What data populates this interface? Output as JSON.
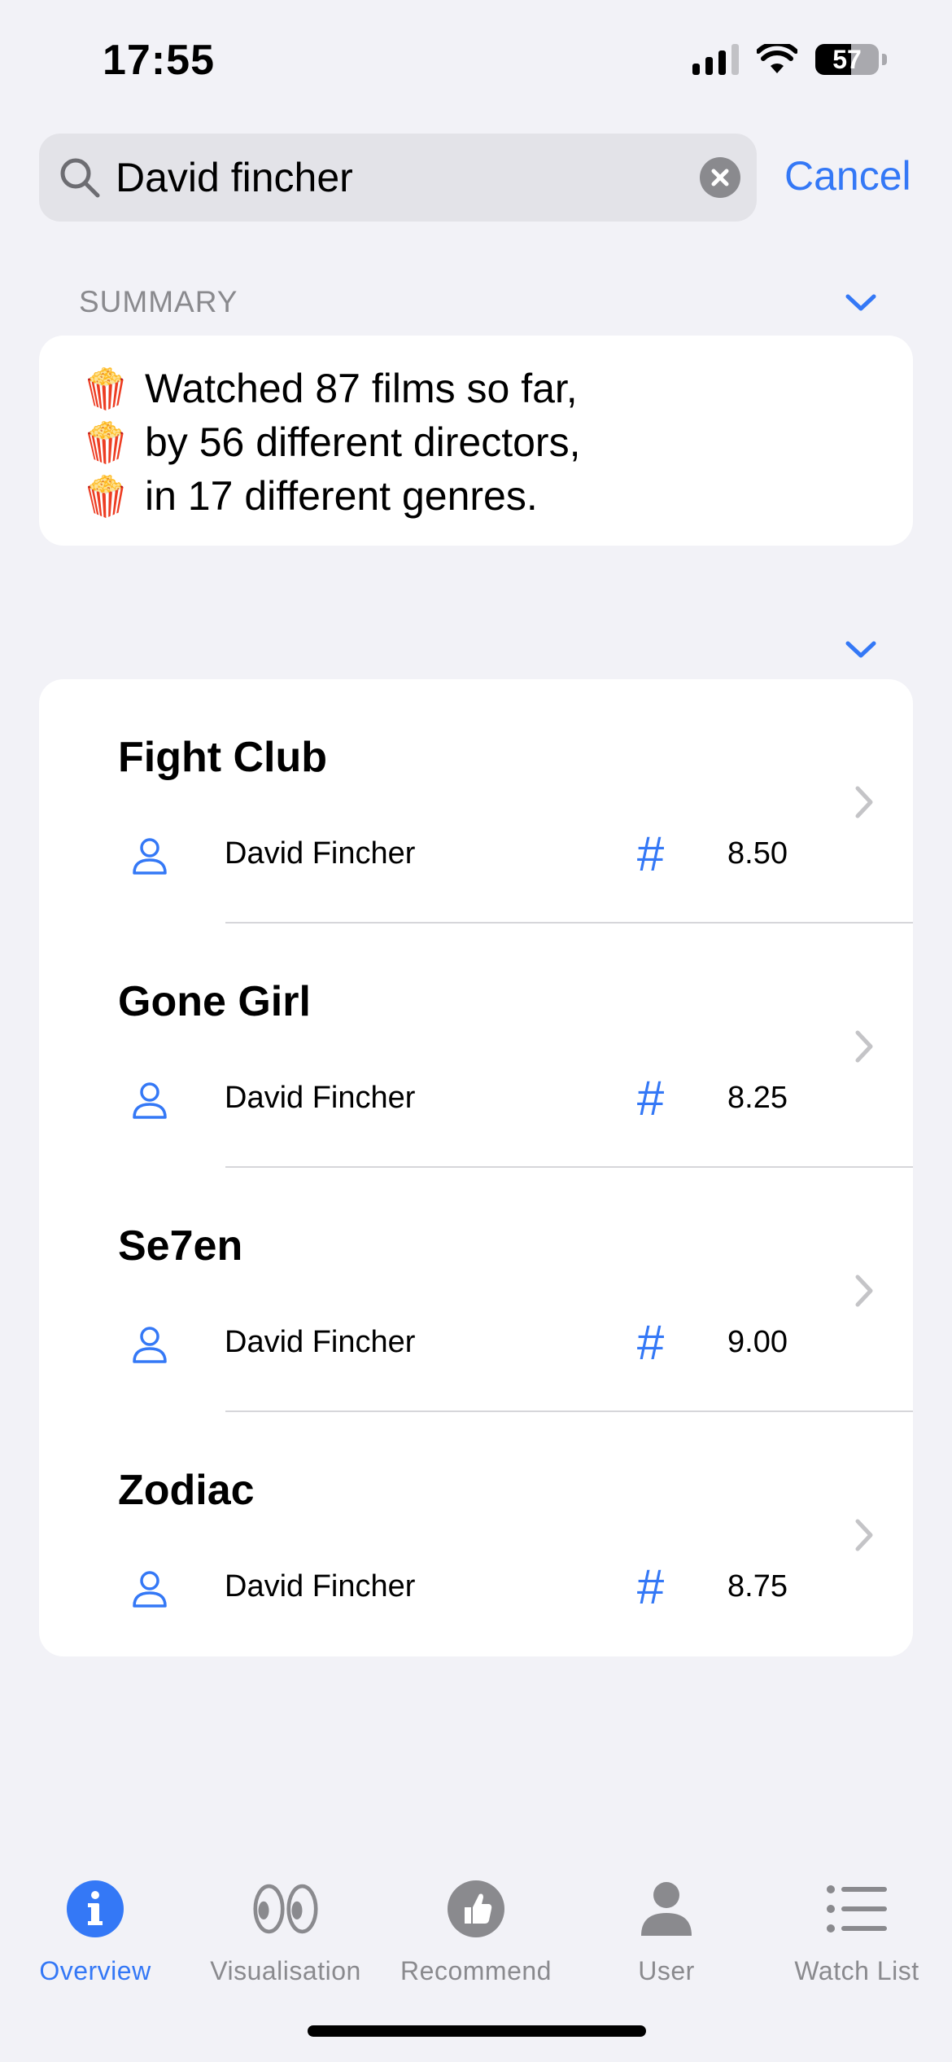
{
  "status_bar": {
    "time": "17:55",
    "battery_percent": "57"
  },
  "search": {
    "value": "David fincher",
    "cancel_label": "Cancel"
  },
  "summary": {
    "header": "SUMMARY",
    "lines": [
      "Watched 87 films so far,",
      "by 56 different directors,",
      "in 17 different genres."
    ],
    "emoji": "🍿"
  },
  "films": [
    {
      "title": "Fight Club",
      "director": "David Fincher",
      "rating": "8.50"
    },
    {
      "title": "Gone Girl",
      "director": "David Fincher",
      "rating": "8.25"
    },
    {
      "title": "Se7en",
      "director": "David Fincher",
      "rating": "9.00"
    },
    {
      "title": "Zodiac",
      "director": "David Fincher",
      "rating": "8.75"
    }
  ],
  "tabs": [
    {
      "label": "Overview",
      "icon": "info-icon",
      "active": true
    },
    {
      "label": "Visualisation",
      "icon": "eyes-icon",
      "active": false
    },
    {
      "label": "Recommend",
      "icon": "thumbs-up-icon",
      "active": false
    },
    {
      "label": "User",
      "icon": "person-icon",
      "active": false
    },
    {
      "label": "Watch List",
      "icon": "list-icon",
      "active": false
    }
  ],
  "colors": {
    "accent": "#3478f6",
    "background": "#f2f2f7",
    "secondary": "#8a8a8e"
  }
}
